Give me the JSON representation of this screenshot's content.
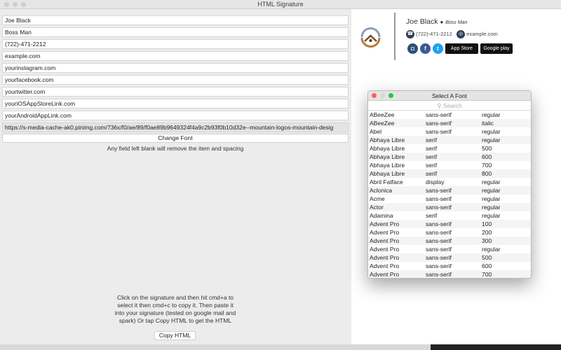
{
  "window": {
    "title": "HTML Signature"
  },
  "form": {
    "fields": [
      "Joe Black",
      "Boss Man",
      "(722)-471-2212",
      "example.com",
      "yourinstagram.com",
      "yourfacebook.com",
      "yourtwitter.com",
      "youriOSAppStoreLink.com",
      "yourAndroidAppLink.com"
    ],
    "image_url": "https://s-media-cache-ak0.pinimg.com/736x/f0/ae/89/f0ae89b9649324f4a9c2b93f0b10d32e--mountain-logos-mountain-desig",
    "change_font_label": "Change Font",
    "blank_note": "Any field left blank will remove the item and spacing",
    "instructions": "Click on the signature and then hit cmd+a to select it then cmd+c to copy it. Then paste it into your signature (tested on google mail and spark) Or tap Copy HTML to get the HTML",
    "copy_html_label": "Copy HTML"
  },
  "signature": {
    "name": "Joe Black",
    "title": "Boss Man",
    "phone": "(722)-471-2212",
    "website": "example.com",
    "app_store": "App Store",
    "google_play": "Google play"
  },
  "font_picker": {
    "title": "Select A Font",
    "search_placeholder": "Search",
    "rows": [
      [
        "ABeeZee",
        "sans-serif",
        "regular"
      ],
      [
        "ABeeZee",
        "sans-serif",
        "italic"
      ],
      [
        "Abel",
        "sans-serif",
        "regular"
      ],
      [
        "Abhaya Libre",
        "serif",
        "regular"
      ],
      [
        "Abhaya Libre",
        "serif",
        "500"
      ],
      [
        "Abhaya Libre",
        "serif",
        "600"
      ],
      [
        "Abhaya Libre",
        "serif",
        "700"
      ],
      [
        "Abhaya Libre",
        "serif",
        "800"
      ],
      [
        "Abril Fatface",
        "display",
        "regular"
      ],
      [
        "Aclonica",
        "sans-serif",
        "regular"
      ],
      [
        "Acme",
        "sans-serif",
        "regular"
      ],
      [
        "Actor",
        "sans-serif",
        "regular"
      ],
      [
        "Adamina",
        "serif",
        "regular"
      ],
      [
        "Advent Pro",
        "sans-serif",
        "100"
      ],
      [
        "Advent Pro",
        "sans-serif",
        "200"
      ],
      [
        "Advent Pro",
        "sans-serif",
        "300"
      ],
      [
        "Advent Pro",
        "sans-serif",
        "regular"
      ],
      [
        "Advent Pro",
        "sans-serif",
        "500"
      ],
      [
        "Advent Pro",
        "sans-serif",
        "600"
      ],
      [
        "Advent Pro",
        "sans-serif",
        "700"
      ]
    ]
  }
}
